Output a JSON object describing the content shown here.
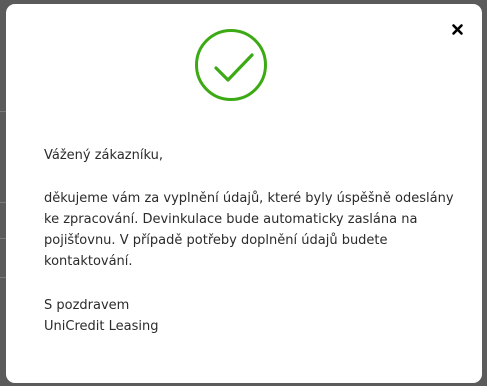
{
  "dialog": {
    "greeting": "Vážený zákazníku,",
    "message": "děkujeme vám za vyplnění údajů, které byly úspěšně odeslány\nke zpracování. Devinkulace bude automaticky zaslána na\npojišťovnu. V případě potřeby doplnění údajů budete\nkontaktování.",
    "closing": "S pozdravem",
    "signature": "UniCredit Leasing",
    "icons": {
      "success": "check-circle-icon",
      "close": "close-icon"
    }
  },
  "colors": {
    "success_green": "#3caa14",
    "backdrop": "#5b5b5b",
    "text": "#2b2b2b"
  }
}
